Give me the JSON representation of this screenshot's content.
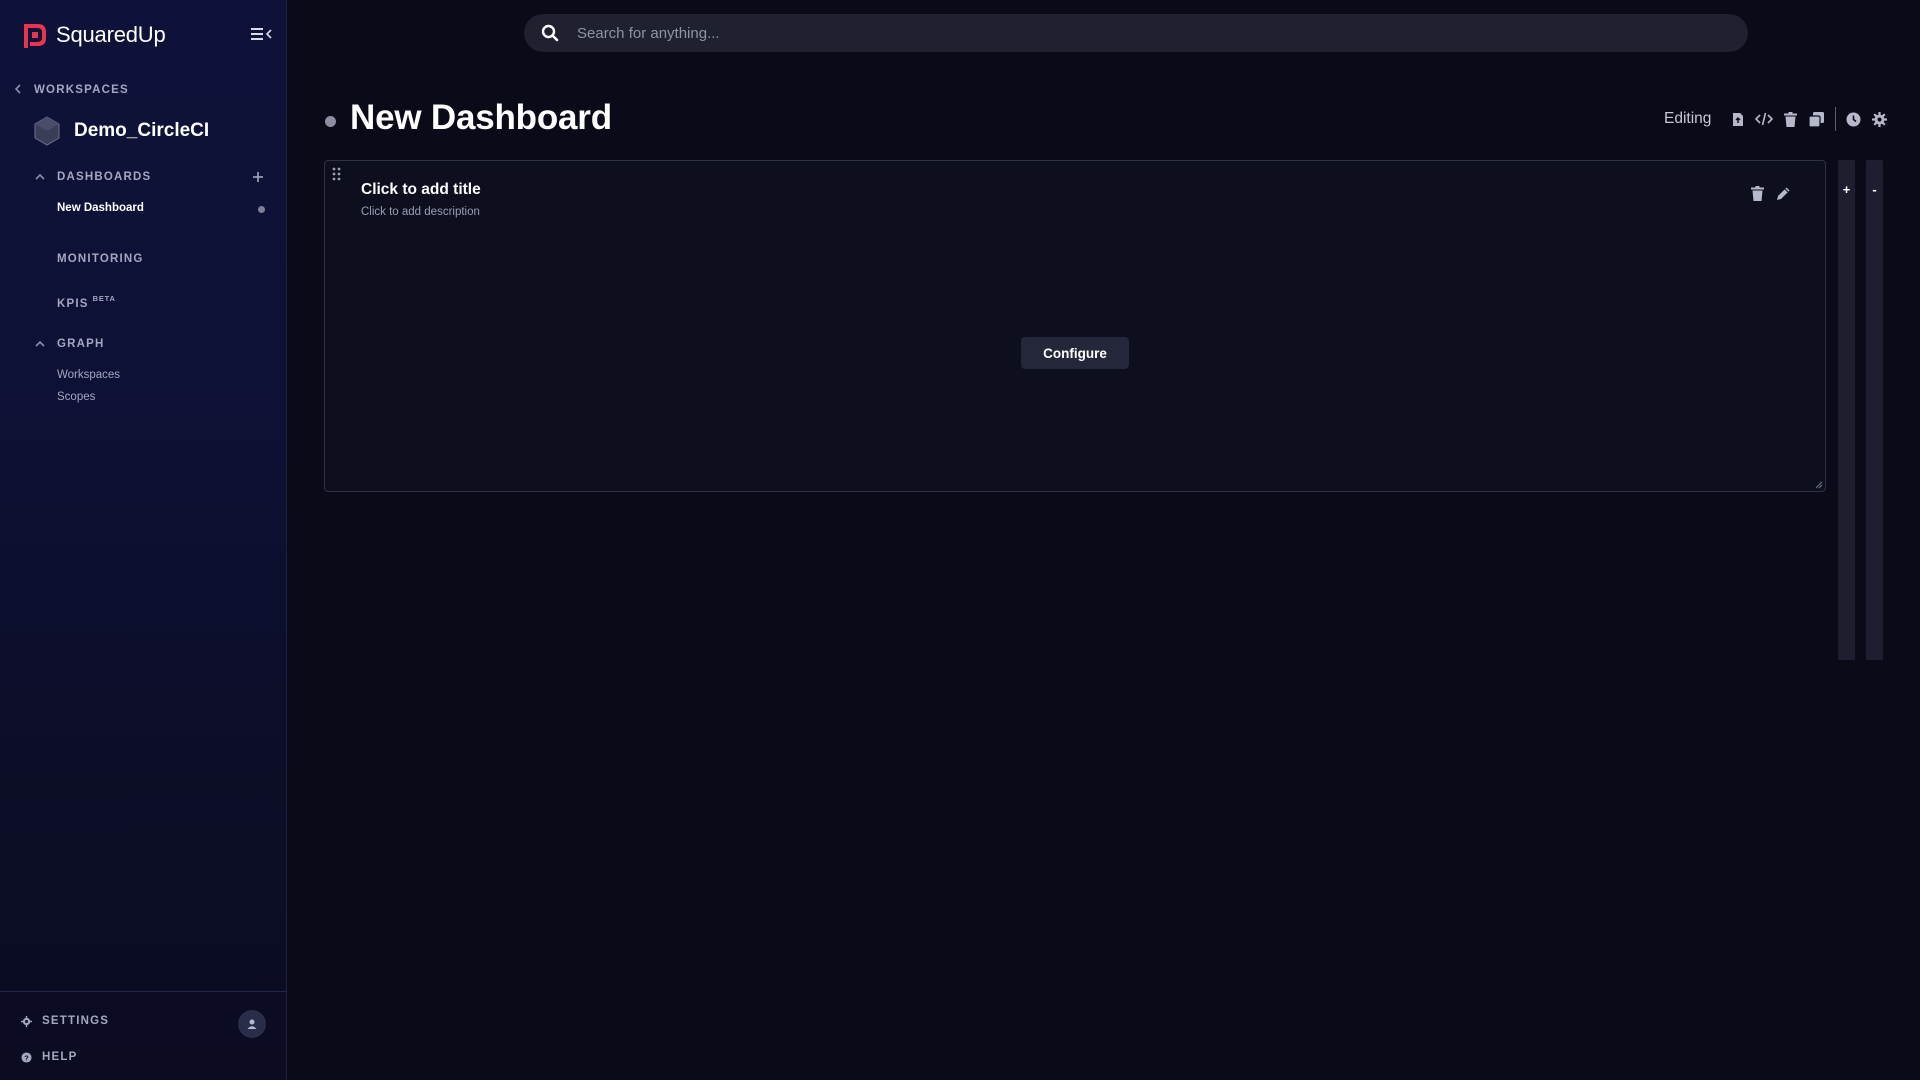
{
  "brand": {
    "name": "SquaredUp",
    "accent": "#e8344e"
  },
  "sidebar": {
    "back_label": "WORKSPACES",
    "workspace_name": "Demo_CircleCI",
    "dashboards_label": "DASHBOARDS",
    "dashboards": [
      {
        "label": "New Dashboard",
        "active": true
      }
    ],
    "monitoring_label": "MONITORING",
    "kpis_label": "KPIS",
    "kpis_badge": "BETA",
    "graph_label": "GRAPH",
    "graph_items": [
      {
        "label": "Workspaces"
      },
      {
        "label": "Scopes"
      }
    ],
    "settings_label": "SETTINGS",
    "help_label": "HELP"
  },
  "search": {
    "placeholder": "Search for anything..."
  },
  "dashboard": {
    "title": "New Dashboard",
    "mode_label": "Editing",
    "tile": {
      "title": "Click to add title",
      "description": "Click to add description",
      "configure_label": "Configure"
    },
    "rail_add_label": "+",
    "rail_remove_label": "-"
  },
  "icons": {
    "collapse": "menu-collapse-icon",
    "search": "search-icon",
    "toolbar": [
      "export-icon",
      "code-icon",
      "trash-icon",
      "copy-icon",
      "clock-icon",
      "gear-icon"
    ],
    "tile": [
      "trash-icon",
      "pencil-icon"
    ]
  }
}
